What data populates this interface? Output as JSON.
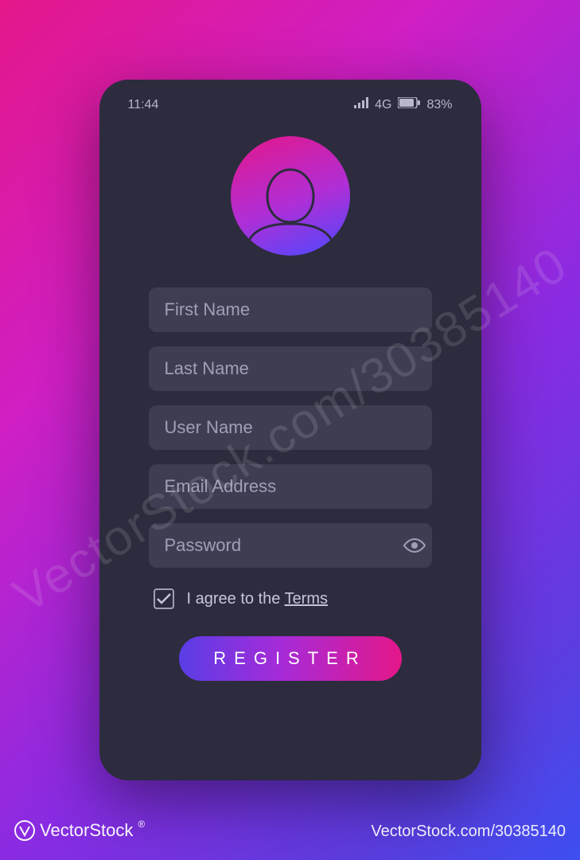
{
  "status": {
    "time": "11:44",
    "network": "4G",
    "battery": "83%"
  },
  "form": {
    "first_name_placeholder": "First Name",
    "last_name_placeholder": "Last Name",
    "user_name_placeholder": "User Name",
    "email_placeholder": "Email Address",
    "password_placeholder": "Password"
  },
  "terms": {
    "prefix": "I agree to the ",
    "link": "Terms",
    "checked": true
  },
  "register_label": "REGISTER",
  "watermark": {
    "brand": "VectorStock",
    "suffix": "®",
    "id": "30385140",
    "site": "VectorStock.com/30385140"
  }
}
